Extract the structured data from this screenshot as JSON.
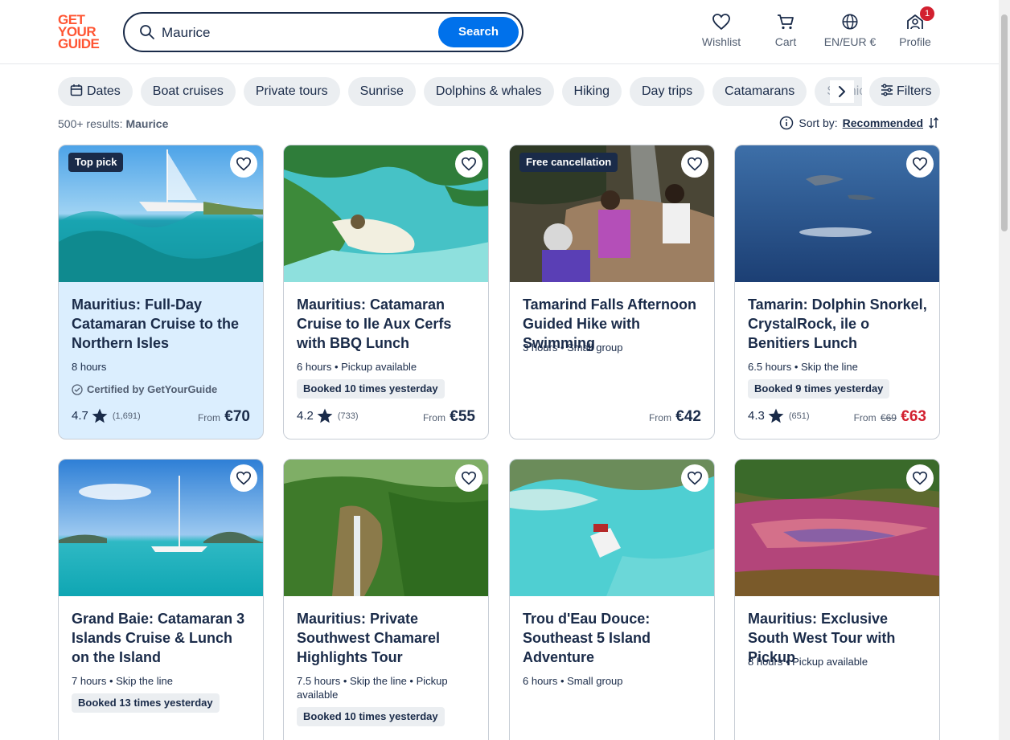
{
  "logo": {
    "lines": [
      "GET",
      "YOUR",
      "GUIDE"
    ]
  },
  "search": {
    "value": "Maurice",
    "button": "Search"
  },
  "nav": {
    "wishlist": "Wishlist",
    "cart": "Cart",
    "language": "EN/EUR €",
    "profile": "Profile",
    "profile_badge": "1"
  },
  "chips": [
    "Dates",
    "Boat cruises",
    "Private tours",
    "Sunrise",
    "Dolphins & whales",
    "Hiking",
    "Day trips",
    "Catamarans",
    "Scenic"
  ],
  "filters_label": "Filters",
  "results": {
    "count": "500+ results:",
    "query": "Maurice"
  },
  "sort": {
    "label": "Sort by:",
    "value": "Recommended"
  },
  "cards": [
    {
      "tag": "Top pick",
      "title": "Mauritius: Full-Day Catamaran Cruise to the Northern Isles",
      "meta": "8 hours",
      "certified": "Certified by GetYourGuide",
      "booked": "",
      "rating": "4.7",
      "reviews": "(1,691)",
      "from": "From",
      "old_price": "",
      "price": "€70"
    },
    {
      "tag": "",
      "title": "Mauritius: Catamaran Cruise to Ile Aux Cerfs with BBQ Lunch",
      "meta": "6 hours • Pickup available",
      "certified": "",
      "booked": "Booked 10 times yesterday",
      "rating": "4.2",
      "reviews": "(733)",
      "from": "From",
      "old_price": "",
      "price": "€55"
    },
    {
      "tag": "Free cancellation",
      "title": "Tamarind Falls Afternoon Guided Hike with Swimming",
      "meta": "3 hours • Small group",
      "certified": "",
      "booked": "",
      "rating": "",
      "reviews": "",
      "from": "From",
      "old_price": "",
      "price": "€42"
    },
    {
      "tag": "",
      "title": "Tamarin: Dolphin Snorkel, CrystalRock, ile o Benitiers Lunch",
      "meta": "6.5 hours • Skip the line",
      "certified": "",
      "booked": "Booked 9 times yesterday",
      "rating": "4.3",
      "reviews": "(651)",
      "from": "From",
      "old_price": "€69",
      "price": "€63"
    },
    {
      "tag": "",
      "title": "Grand Baie: Catamaran 3 Islands Cruise & Lunch on the Island",
      "meta": "7 hours • Skip the line",
      "certified": "",
      "booked": "Booked 13 times yesterday",
      "rating": "",
      "reviews": "",
      "from": "",
      "old_price": "",
      "price": ""
    },
    {
      "tag": "",
      "title": "Mauritius: Private Southwest Chamarel Highlights Tour",
      "meta": "7.5 hours • Skip the line • Pickup available",
      "certified": "",
      "booked": "Booked 10 times yesterday",
      "rating": "",
      "reviews": "",
      "from": "",
      "old_price": "",
      "price": ""
    },
    {
      "tag": "",
      "title": "Trou d'Eau Douce: Southeast 5 Island Adventure",
      "meta": "6 hours • Small group",
      "certified": "",
      "booked": "",
      "rating": "",
      "reviews": "",
      "from": "",
      "old_price": "",
      "price": ""
    },
    {
      "tag": "",
      "title": "Mauritius: Exclusive South West Tour with Pickup",
      "meta": "8 hours • Pickup available",
      "certified": "",
      "booked": "",
      "rating": "",
      "reviews": "",
      "from": "",
      "old_price": "",
      "price": ""
    }
  ],
  "colors": {
    "brand": "#ff5533",
    "accent": "#0071eb",
    "text": "#1a2b49",
    "sale": "#d2202f",
    "chip_bg": "#ebeef1",
    "highlight": "#dbeefe"
  }
}
